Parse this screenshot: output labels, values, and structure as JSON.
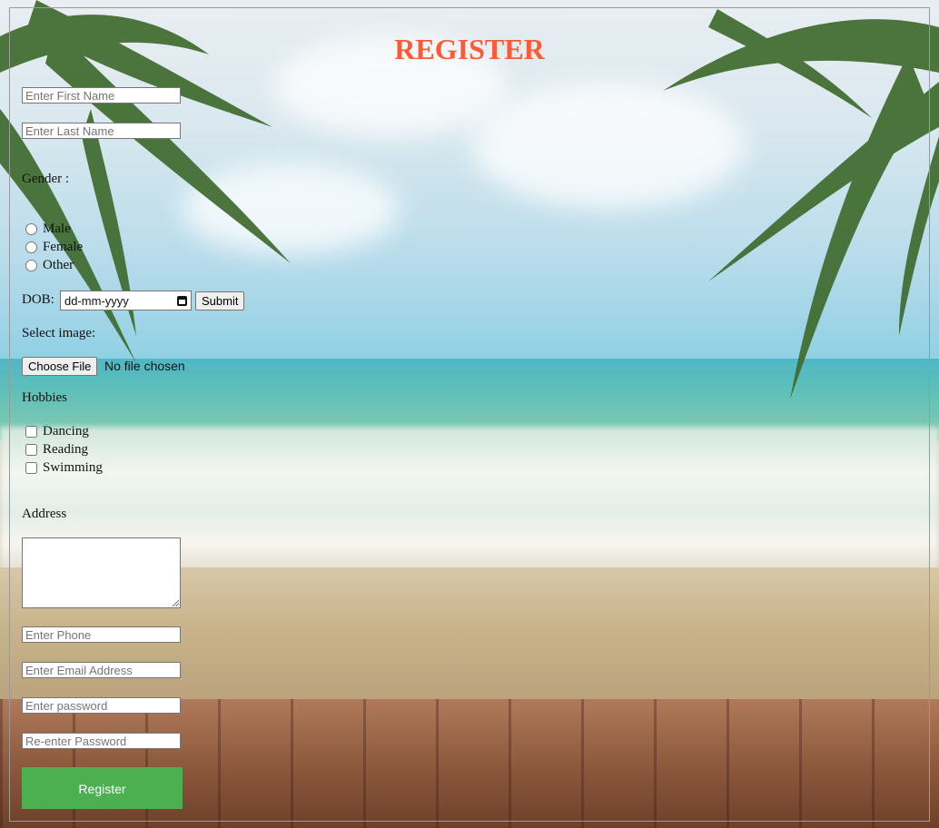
{
  "page": {
    "title": "REGISTER"
  },
  "fields": {
    "first_name_placeholder": "Enter First Name",
    "last_name_placeholder": "Enter Last Name",
    "phone_placeholder": "Enter Phone",
    "email_placeholder": "Enter Email Address",
    "password_placeholder": "Enter password",
    "reenter_password_placeholder": "Re-enter Password"
  },
  "gender": {
    "label": "Gender :",
    "options": [
      "Male",
      "Female",
      "Other"
    ]
  },
  "dob": {
    "label": "DOB:",
    "placeholder": "dd-mm-yyyy",
    "submit_label": "Submit"
  },
  "image": {
    "label": "Select image:",
    "button_label": "Choose File",
    "status": "No file chosen"
  },
  "hobbies": {
    "label": "Hobbies",
    "options": [
      "Dancing",
      "Reading",
      "Swimming"
    ]
  },
  "address": {
    "label": "Address"
  },
  "register_button": "Register",
  "colors": {
    "title": "#ff5a36",
    "register_button": "#4caf50"
  },
  "icons": {
    "calendar": "calendar-icon"
  }
}
